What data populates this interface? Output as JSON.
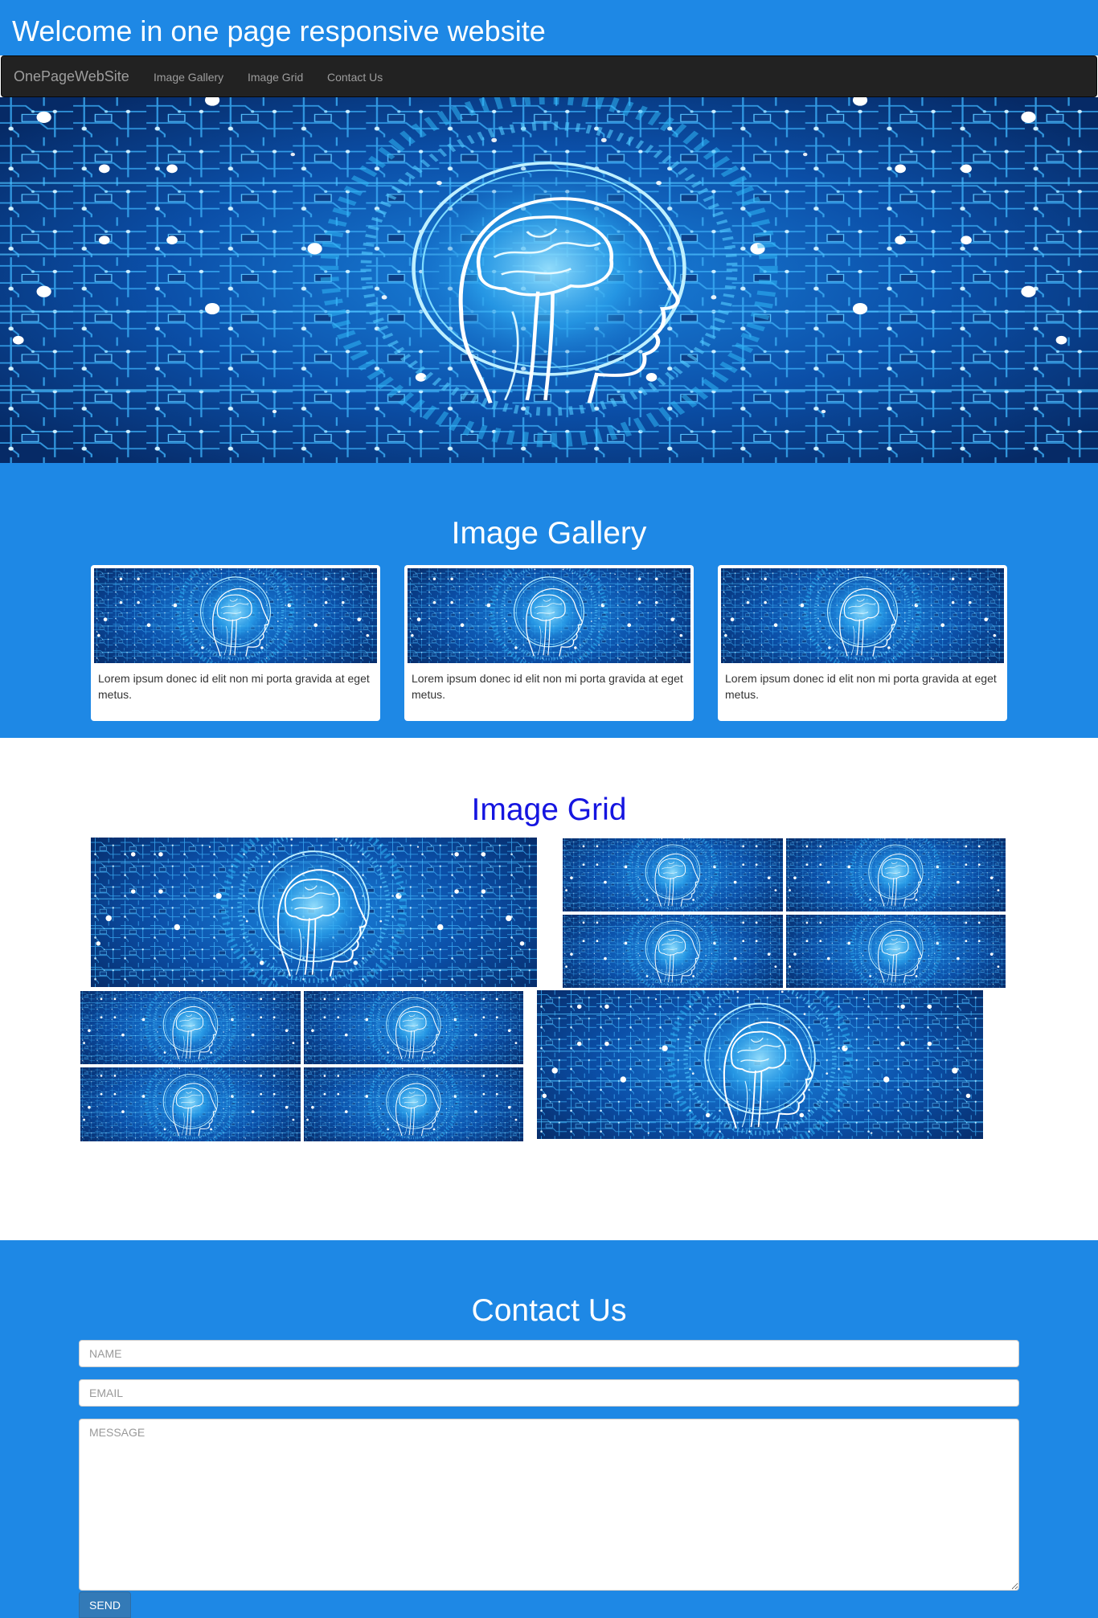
{
  "header": {
    "title": "Welcome in one page responsive website"
  },
  "navbar": {
    "brand": "OnePageWebSite",
    "links": [
      "Image Gallery",
      "Image Grid",
      "Contact Us"
    ]
  },
  "gallery": {
    "title": "Image Gallery",
    "cards": [
      {
        "caption": "Lorem ipsum donec id elit non mi porta gravida at eget metus."
      },
      {
        "caption": "Lorem ipsum donec id elit non mi porta gravida at eget metus."
      },
      {
        "caption": "Lorem ipsum donec id elit non mi porta gravida at eget metus."
      }
    ]
  },
  "grid": {
    "title": "Image Grid"
  },
  "contact": {
    "title": "Contact Us",
    "name_placeholder": "NAME",
    "email_placeholder": "EMAIL",
    "message_placeholder": "MESSAGE",
    "send_label": "SEND"
  },
  "colors": {
    "page_blue": "#1e88e5",
    "navbar_bg": "#222222",
    "grid_title": "#1515e0",
    "send_button": "#337ab7"
  },
  "images": {
    "icon": "ai-brain-circuit-image"
  }
}
